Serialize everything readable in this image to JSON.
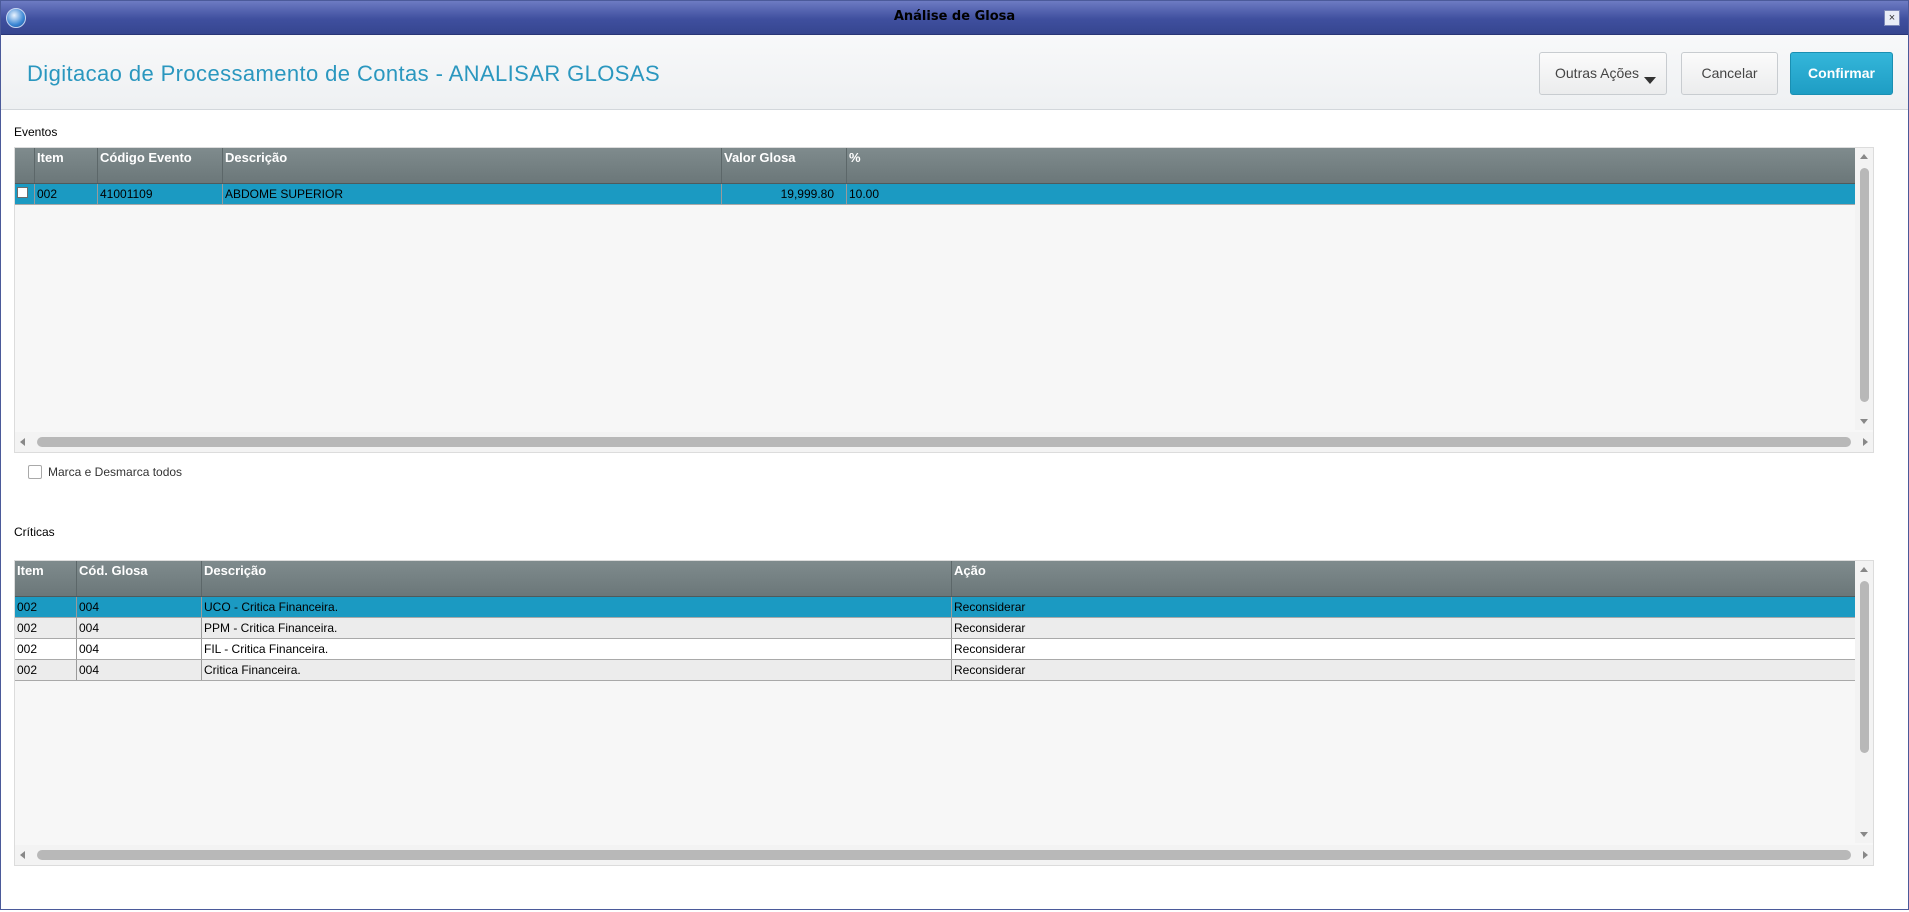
{
  "window": {
    "title": "Análise de Glosa",
    "close_glyph": "×"
  },
  "header": {
    "title": "Digitacao de Processamento de Contas - ANALISAR GLOSAS",
    "buttons": {
      "outras": "Outras Ações",
      "cancelar": "Cancelar",
      "confirmar": "Confirmar"
    }
  },
  "eventos": {
    "label": "Eventos",
    "columns": [
      "Item",
      "Código Evento",
      "Descrição",
      "Valor Glosa",
      "%"
    ],
    "rows": [
      {
        "checked": false,
        "item": "002",
        "codigo": "41001109",
        "descricao": "ABDOME SUPERIOR",
        "valor": "19,999.80",
        "pct": "10.00"
      }
    ]
  },
  "marca": {
    "label": "Marca e Desmarca todos",
    "checked": false
  },
  "criticas": {
    "label": "Críticas",
    "columns": [
      "Item",
      "Cód. Glosa",
      "Descrição",
      "Ação"
    ],
    "rows": [
      {
        "item": "002",
        "cod": "004",
        "descricao": "UCO - Critica Financeira.",
        "acao": "Reconsiderar"
      },
      {
        "item": "002",
        "cod": "004",
        "descricao": "PPM - Critica Financeira.",
        "acao": "Reconsiderar"
      },
      {
        "item": "002",
        "cod": "004",
        "descricao": "FIL - Critica Financeira.",
        "acao": "Reconsiderar"
      },
      {
        "item": "002",
        "cod": "004",
        "descricao": "Critica Financeira.",
        "acao": "Reconsiderar"
      }
    ]
  },
  "colors": {
    "accent": "#1b9ac2",
    "title_text": "#2a97bf",
    "header_grid": "#6b7779"
  }
}
